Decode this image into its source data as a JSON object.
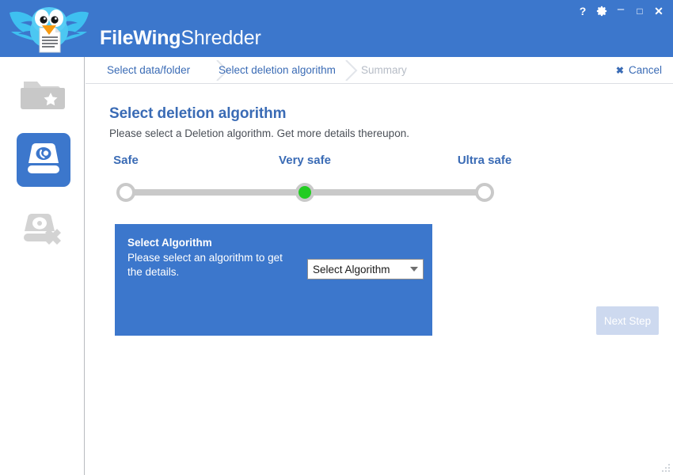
{
  "window": {
    "brand": "FileWing",
    "product": "Shredder",
    "controls": [
      {
        "name": "help-button",
        "glyph": "?"
      },
      {
        "name": "settings-button",
        "glyph": "gear-icon"
      },
      {
        "name": "minimize-button",
        "glyph": "–"
      },
      {
        "name": "maximize-button",
        "glyph": "□"
      },
      {
        "name": "close-button",
        "glyph": "✕"
      }
    ]
  },
  "sidebar": {
    "items": [
      {
        "icon": "folder-star-icon",
        "state": "inactive"
      },
      {
        "icon": "disk-shredder-icon",
        "state": "active"
      },
      {
        "icon": "disk-delete-icon",
        "state": "inactive"
      }
    ]
  },
  "breadcrumb": {
    "steps": [
      {
        "label": "Select data/folder",
        "state": "done"
      },
      {
        "label": "Select deletion algorithm",
        "state": "current"
      },
      {
        "label": "Summary",
        "state": "disabled"
      }
    ],
    "cancel_label": "Cancel",
    "cancel_icon": "close-icon"
  },
  "main": {
    "title": "Select deletion algorithm",
    "subtitle": "Please select a Deletion algorithm. Get more details thereupon.",
    "slider": {
      "selected_index": 1,
      "levels": [
        {
          "label": "Safe",
          "selected": false
        },
        {
          "label": "Very safe",
          "selected": true
        },
        {
          "label": "Ultra safe",
          "selected": false
        }
      ]
    },
    "algorithm_panel": {
      "title": "Select Algorithm",
      "description": "Please select an algorithm to get the details.",
      "select_value": "Select Algorithm",
      "select_options": [
        "Select Algorithm"
      ]
    },
    "next_button": {
      "label": "Next Step",
      "enabled": false
    }
  },
  "colors": {
    "brand_blue": "#3c77cc",
    "link_blue": "#3a6bb5",
    "slider_track": "#c9c9c9",
    "slider_active": "#22cc22",
    "disabled_button": "#cdd9ef",
    "disabled_text": "#b6bcc6"
  }
}
